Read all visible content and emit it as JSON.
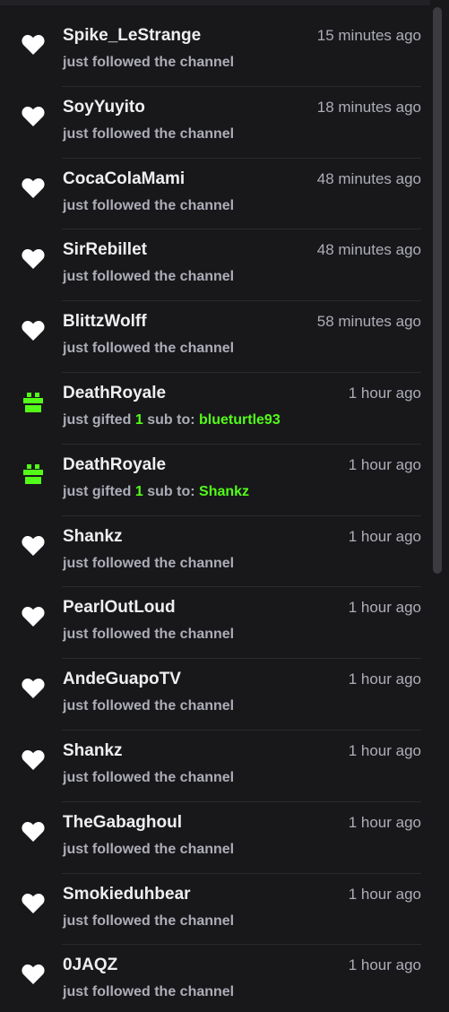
{
  "colors": {
    "background": "#18181b",
    "username": "#efeff1",
    "muted": "#adadb8",
    "accent_green": "#53fc18",
    "heart": "#ffffff"
  },
  "feed": [
    {
      "type": "follow",
      "icon": "heart-icon",
      "username": "Spike_LeStrange",
      "time": "15 minutes ago",
      "action": "just followed the channel"
    },
    {
      "type": "follow",
      "icon": "heart-icon",
      "username": "SoyYuyito",
      "time": "18 minutes ago",
      "action": "just followed the channel"
    },
    {
      "type": "follow",
      "icon": "heart-icon",
      "username": "CocaColaMami",
      "time": "48 minutes ago",
      "action": "just followed the channel"
    },
    {
      "type": "follow",
      "icon": "heart-icon",
      "username": "SirRebillet",
      "time": "48 minutes ago",
      "action": "just followed the channel"
    },
    {
      "type": "follow",
      "icon": "heart-icon",
      "username": "BlittzWolff",
      "time": "58 minutes ago",
      "action": "just followed the channel"
    },
    {
      "type": "gift",
      "icon": "gift-icon",
      "username": "DeathRoyale",
      "time": "1 hour ago",
      "action_prefix": "just gifted",
      "count": "1",
      "action_mid": "sub to:",
      "recipient": "blueturtle93"
    },
    {
      "type": "gift",
      "icon": "gift-icon",
      "username": "DeathRoyale",
      "time": "1 hour ago",
      "action_prefix": "just gifted",
      "count": "1",
      "action_mid": "sub to:",
      "recipient": "Shankz"
    },
    {
      "type": "follow",
      "icon": "heart-icon",
      "username": "Shankz",
      "time": "1 hour ago",
      "action": "just followed the channel"
    },
    {
      "type": "follow",
      "icon": "heart-icon",
      "username": "PearlOutLoud",
      "time": "1 hour ago",
      "action": "just followed the channel"
    },
    {
      "type": "follow",
      "icon": "heart-icon",
      "username": "AndeGuapoTV",
      "time": "1 hour ago",
      "action": "just followed the channel"
    },
    {
      "type": "follow",
      "icon": "heart-icon",
      "username": "Shankz",
      "time": "1 hour ago",
      "action": "just followed the channel"
    },
    {
      "type": "follow",
      "icon": "heart-icon",
      "username": "TheGabaghoul",
      "time": "1 hour ago",
      "action": "just followed the channel"
    },
    {
      "type": "follow",
      "icon": "heart-icon",
      "username": "Smokieduhbear",
      "time": "1 hour ago",
      "action": "just followed the channel"
    },
    {
      "type": "follow",
      "icon": "heart-icon",
      "username": "0JAQZ",
      "time": "1 hour ago",
      "action": "just followed the channel"
    }
  ]
}
